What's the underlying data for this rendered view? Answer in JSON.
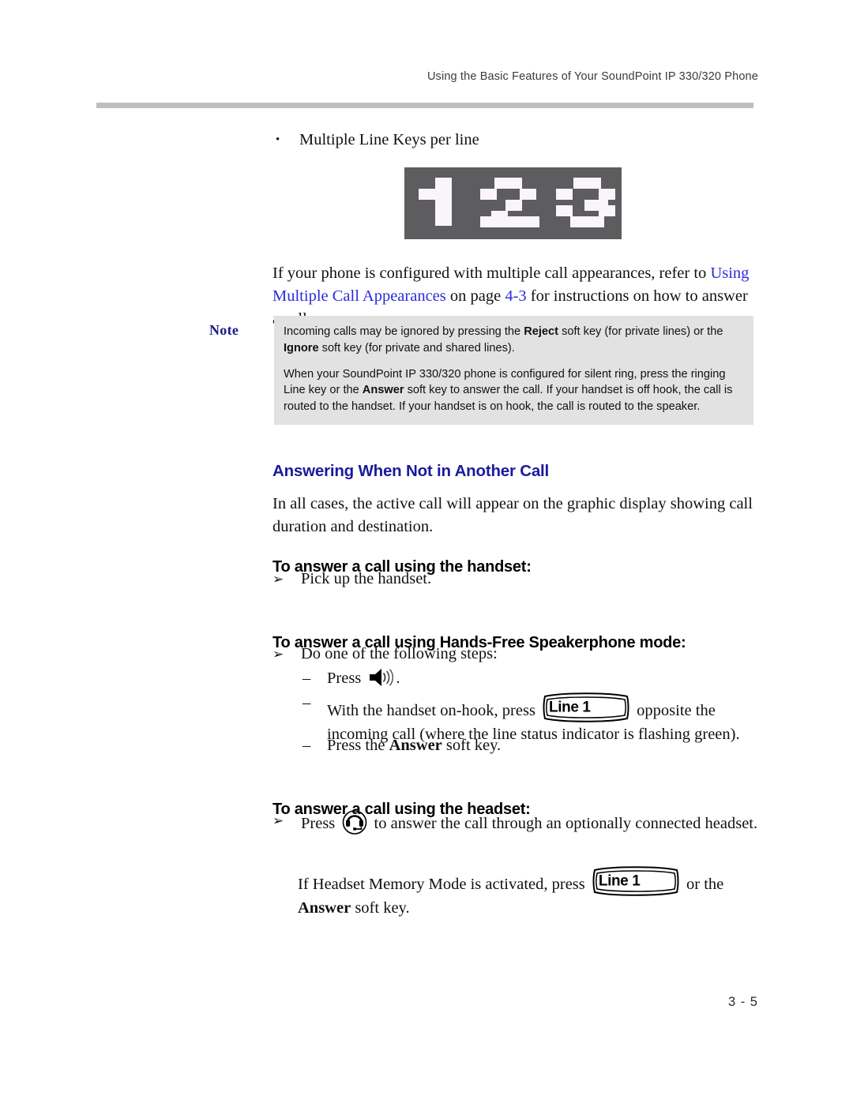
{
  "header": {
    "running_title": "Using the Basic Features of Your SoundPoint IP 330/320 Phone"
  },
  "bullet": {
    "marker": "•",
    "text": "Multiple Line Keys per line"
  },
  "lcd_graphic": {
    "name": "line-keys-lcd-display",
    "content": "123",
    "background_color": "#5d5c5e",
    "pixel_color": "#faf5fa"
  },
  "paragraphs": {
    "multiple_appearances": {
      "lead": "If your phone is configured with multiple call appearances, refer to ",
      "link1": "Using Multiple Call Appearances",
      "mid": " on page ",
      "link2": "4-3",
      "tail": " for instructions on how to answer a call."
    },
    "all_cases": "In all cases, the active call will appear on the graphic display showing call duration and destination.",
    "memory_mode": {
      "lead": "If Headset Memory Mode is activated, press ",
      "mid": " or the ",
      "bold": "Answer",
      "tail": " soft key."
    }
  },
  "note": {
    "label": "Note",
    "background_color": "#e2e2e2",
    "label_color": "#1a1a8c",
    "paragraph1": {
      "a": "Incoming calls may be ignored by pressing the ",
      "b1": "Reject",
      "b": " soft key (for private lines) or the ",
      "b2": "Ignore",
      "c": " soft key (for private and shared lines)."
    },
    "paragraph2": {
      "a": "When your SoundPoint IP 330/320 phone is configured for silent ring, press the ringing Line key or the ",
      "b1": "Answer",
      "b": " soft key to answer the call. If your handset is off hook, the call is routed to the handset. If your handset is on hook, the call is routed to the speaker."
    }
  },
  "section": {
    "heading": "Answering When Not in Another Call",
    "heading_color": "#1a1a9c"
  },
  "subsections": {
    "handset": "To answer a call using the handset:",
    "speakerphone": "To answer a call using Hands-Free Speakerphone mode:",
    "headset": "To answer a call using the headset:"
  },
  "steps": {
    "arrow_marker": "➢",
    "dash_marker": "–",
    "pick_up_handset": "Pick up the handset.",
    "do_one_of_following": "Do one of the following steps:",
    "press_speaker": {
      "lead": "Press ",
      "tail": "."
    },
    "on_hook_line_key": {
      "lead": "With the handset on-hook, press ",
      "tail": " opposite the incoming call (where the line status indicator is flashing green)."
    },
    "press_answer_soft_key": {
      "lead": "Press the ",
      "bold": "Answer",
      "tail": " soft key."
    },
    "headset_press": {
      "lead": "Press ",
      "tail": " to answer the call through an optionally connected headset."
    }
  },
  "line_key": {
    "label": "Line 1"
  },
  "footer": {
    "page_number": "3 - 5"
  }
}
